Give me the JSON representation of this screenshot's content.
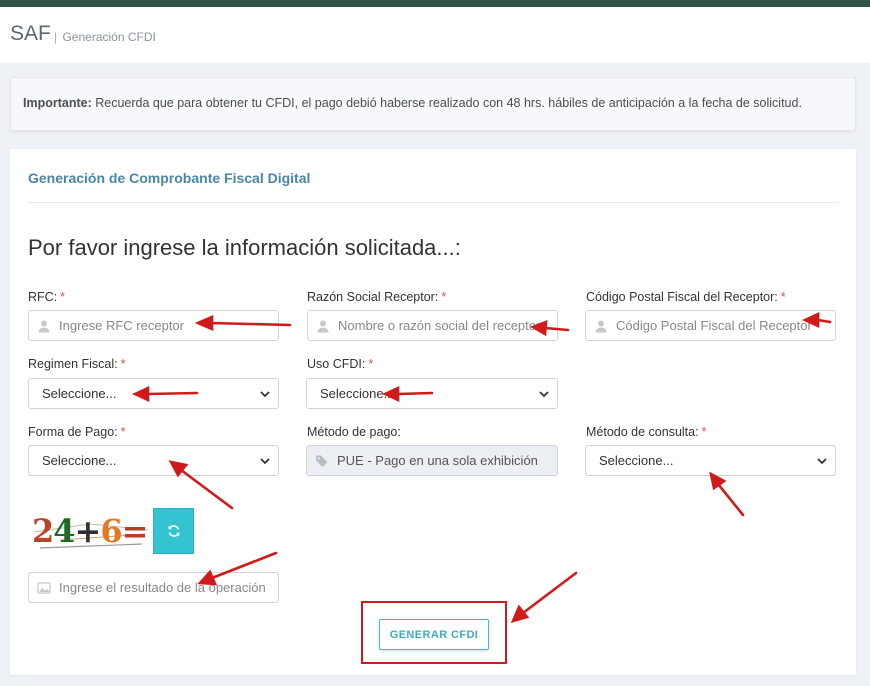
{
  "header": {
    "brand": "SAF",
    "separator": "|",
    "subtitle": "Generación CFDI"
  },
  "alert": {
    "label": "Importante:",
    "message": " Recuerda que para obtener tu CFDI, el pago debió haberse realizado con 48 hrs. hábiles de anticipación a la fecha de solicitud."
  },
  "card": {
    "title": "Generación de Comprobante Fiscal Digital",
    "heading": "Por favor ingrese la información solicitada...:"
  },
  "form": {
    "rfc": {
      "label": "RFC:",
      "required": "*",
      "placeholder": "Ingrese RFC receptor",
      "icon": "user-icon"
    },
    "razon": {
      "label": "Razón Social Receptor:",
      "required": "*",
      "placeholder": "Nombre o razón social del receptor",
      "icon": "user-icon"
    },
    "cp": {
      "label": "Código Postal Fiscal del Receptor:",
      "required": "*",
      "placeholder": "Código Postal Fiscal del Receptor",
      "icon": "user-icon"
    },
    "regimen": {
      "label": "Regimen Fiscal:",
      "required": "*",
      "value": "Seleccione..."
    },
    "uso": {
      "label": "Uso CFDI:",
      "required": "*",
      "value": "Seleccione..."
    },
    "forma": {
      "label": "Forma de Pago:",
      "required": "*",
      "value": "Seleccione..."
    },
    "metodo_pago": {
      "label": "Método de pago:",
      "value": "PUE - Pago en una sola exhibición",
      "icon": "tag-icon"
    },
    "metodo_consulta": {
      "label": "Método de consulta:",
      "required": "*",
      "value": "Seleccione..."
    },
    "captcha": {
      "text": "24+6=",
      "placeholder": "Ingrese el resultado de la operación",
      "icon": "image-icon"
    }
  },
  "actions": {
    "submit": "GENERAR CFDI"
  },
  "colors": {
    "topbar": "#2d5547",
    "accent": "#34c3d1",
    "title": "#4a86a8",
    "required": "#d9534f",
    "annotation": "#d21a1a"
  }
}
